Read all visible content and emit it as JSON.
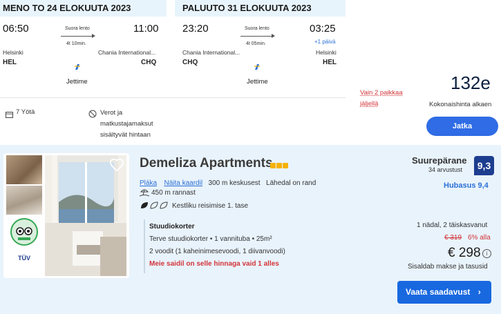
{
  "outbound": {
    "header": "MENO TO 24 ELOKUUTA 2023",
    "depart_time": "06:50",
    "arrive_time": "11:00",
    "flight_type": "Suora lento",
    "duration": "4t 10min.",
    "origin_city": "Helsinki",
    "origin_code": "HEL",
    "dest_city": "Chania International...",
    "dest_code": "CHQ",
    "airline": "Jettime"
  },
  "return": {
    "header": "PALUUTO 31 ELOKUUTA 2023",
    "depart_time": "23:20",
    "arrive_time": "03:25",
    "flight_type": "Suora lento",
    "duration": "4t 05min.",
    "plus_day": "+1 päivä",
    "origin_city": "Chania International...",
    "origin_code": "CHQ",
    "dest_city": "Helsinki",
    "dest_code": "HEL",
    "airline": "Jettime"
  },
  "package": {
    "nights": "7 Yötä",
    "taxes_line1": "Verot ja",
    "taxes_line2": "matkustajamaksut",
    "taxes_line3": "sisältyvät hintaan",
    "seats_line1": "Vain 2 paikkaa",
    "seats_line2": "jäljellä",
    "price": "132e",
    "price_label": "Kokonaishinta alkaen",
    "continue_label": "Jatka"
  },
  "hotel": {
    "name": "Demeliza Apartments",
    "stars": 3,
    "area_link": "Pláka",
    "map_link": "Näita kaardil",
    "distance_center": "300 m keskusest",
    "near": "Lähedal on rand",
    "distance_beach": "450 m rannast",
    "sustainability": "Kestliku reisimise 1. tase",
    "room_title": "Stuudiokorter",
    "room_details": "Terve stuudiokorter • 1 vannituba • 25m²",
    "beds": "2 voodit (1 kaheinimesevoodi, 1 diivanvoodi)",
    "last_room": "Meie saidil on selle hinnaga vaid 1 alles",
    "rating_word": "Suurepärane",
    "reviews": "34 arvustust",
    "rating_score": "9,3",
    "location_score": "Hubasus 9,4",
    "stay": "1 nädal, 2 täiskasvanut",
    "old_price": "€ 319",
    "discount": "6% alla",
    "price": "€ 298",
    "price_note": "Sisaldab makse ja tasusid",
    "availability_label": "Vaata saadavust",
    "badge_tuv": "TÜV"
  },
  "colors": {
    "accent": "#2f6ce5",
    "header_bg": "#e8f4fb",
    "rating_badge": "#1d3d8f",
    "alert_red": "#d2343a"
  }
}
